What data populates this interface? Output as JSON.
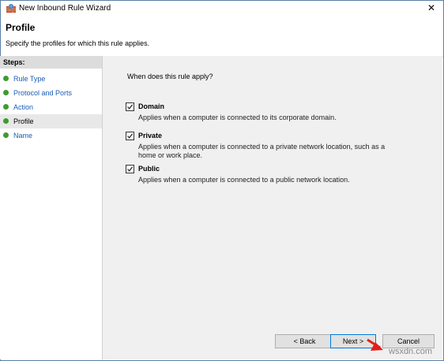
{
  "window": {
    "title": "New Inbound Rule Wizard",
    "close_glyph": "✕"
  },
  "header": {
    "title": "Profile",
    "subtitle": "Specify the profiles for which this rule applies."
  },
  "steps": {
    "heading": "Steps:",
    "items": [
      {
        "label": "Rule Type"
      },
      {
        "label": "Protocol and Ports"
      },
      {
        "label": "Action"
      },
      {
        "label": "Profile"
      },
      {
        "label": "Name"
      }
    ]
  },
  "content": {
    "question": "When does this rule apply?",
    "options": [
      {
        "label": "Domain",
        "checked": true,
        "description": "Applies when a computer is connected to its corporate domain."
      },
      {
        "label": "Private",
        "checked": true,
        "description": "Applies when a computer is connected to a private network location, such as a home or work place."
      },
      {
        "label": "Public",
        "checked": true,
        "description": "Applies when a computer is connected to a public network location."
      }
    ]
  },
  "buttons": {
    "back": "< Back",
    "next": "Next >",
    "cancel": "Cancel"
  },
  "watermark": "wsxdn.com",
  "colors": {
    "accent": "#0078d7",
    "step_dot": "#3d9c2e",
    "link": "#1a5db4",
    "arrow": "#e0201a"
  }
}
